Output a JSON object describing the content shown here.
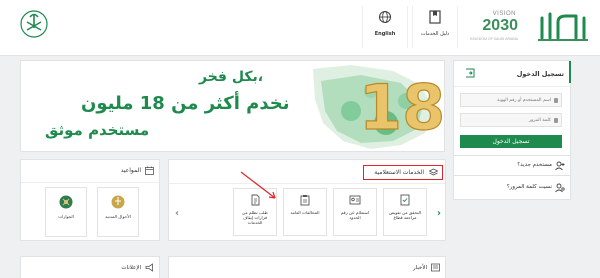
{
  "header": {
    "vision_text": "VISION",
    "vision_year": "2030",
    "vision_sub": "KINGDOM OF SAUDI ARABIA",
    "services_guide_label": "دليل الخدمات",
    "english_label": "English"
  },
  "login": {
    "title": "تسجيل الدخول",
    "username_placeholder": "اسم المستخدم أو رقم الهوية",
    "password_placeholder": "كلمة المرور",
    "login_button": "تسجيل الدخول",
    "new_user": "مستخدم جديد؟",
    "forgot_password": "نسيت كلمة المرور؟"
  },
  "banner": {
    "line1": "بكل فخر،",
    "line2": "نخدم أكثر من 18 مليون",
    "line3": "مستخدم موثق",
    "big_number": "18"
  },
  "services": {
    "title": "الخدمات الاستعلامية",
    "items": [
      {
        "label": "التحقق من تفويض مراجعة قطاع"
      },
      {
        "label": "استعلام عن رقم الحدود"
      },
      {
        "label": "المخالفات العامة"
      },
      {
        "label": "طلب تظلم من قرارات إيقاف الخدمات"
      }
    ]
  },
  "appointments": {
    "title": "المواعيد",
    "items": [
      {
        "label": "الأحوال المدنية"
      },
      {
        "label": "الجوازات"
      }
    ]
  },
  "bottom": {
    "news": "الأخبار",
    "announcements": "الإعلانات"
  },
  "colors": {
    "brand_green": "#1e8a4e",
    "highlight_red": "#e0252a"
  }
}
